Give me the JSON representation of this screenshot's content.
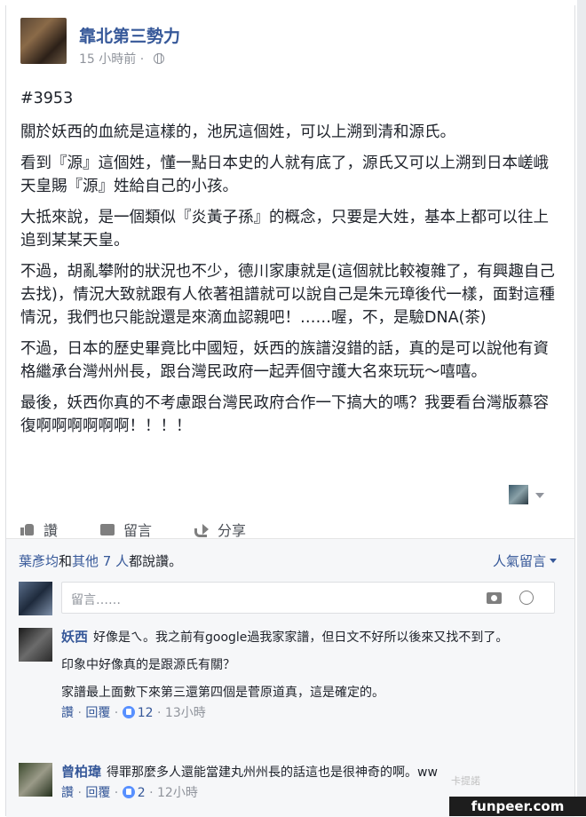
{
  "post": {
    "page_name": "靠北第三勢力",
    "timestamp": "15 小時前 ·",
    "paragraphs": [
      "#3953",
      "關於妖西的血統是這樣的，池尻這個姓，可以上溯到清和源氏。",
      "看到『源』這個姓，懂一點日本史的人就有底了，源氏又可以上溯到日本嵯峨天皇賜『源』姓給自己的小孩。",
      "大抵來說，是一個類似『炎黃子孫』的概念，只要是大姓，基本上都可以往上追到某某天皇。",
      "不過，胡亂攀附的狀況也不少，德川家康就是(這個就比較複雜了，有興趣自己去找)，情況大致就跟有人依著祖譜就可以說自己是朱元璋後代一樣，面對這種情況，我們也只能說還是來滴血認親吧！……喔，不，是驗DNA(茶)",
      "不過，日本的歷史畢竟比中國短，妖西的族譜沒錯的話，真的是可以說他有資格繼承台灣州州長，跟台灣民政府一起弄個守護大名來玩玩～嘻嘻。",
      "最後，妖西你真的不考慮跟台灣民政府合作一下搞大的嗎？我要看台灣版慕容復啊啊啊啊啊啊！！！！"
    ]
  },
  "actions": {
    "like": "讚",
    "comment": "留言",
    "share": "分享"
  },
  "likes": {
    "first_name": "葉彥均",
    "and_text": "和",
    "others_text": "其他 7 人",
    "suffix": "都說讚。",
    "sort_label": "人氣留言"
  },
  "composer": {
    "placeholder": "留言……"
  },
  "comments": [
    {
      "author": "妖西",
      "paragraphs": [
        "好像是ㄟ。我之前有google過我家家譜，但日文不好所以後來又找不到了。",
        "印象中好像真的是跟源氏有關？",
        "家譜最上面數下來第三還第四個是菅原道真，這是確定的。"
      ],
      "like_label": "讚",
      "reply_label": "回覆",
      "likes": "12",
      "time": "13小時"
    },
    {
      "author": "曾柏瑋",
      "paragraphs": [
        "得罪那麼多人還能當建丸州州長的話這也是很神奇的啊。ww"
      ],
      "like_label": "讚",
      "reply_label": "回覆",
      "likes": "2",
      "time": "12小時"
    }
  ],
  "watermark": {
    "site": "funpeer.com",
    "small": "卡提諾"
  }
}
